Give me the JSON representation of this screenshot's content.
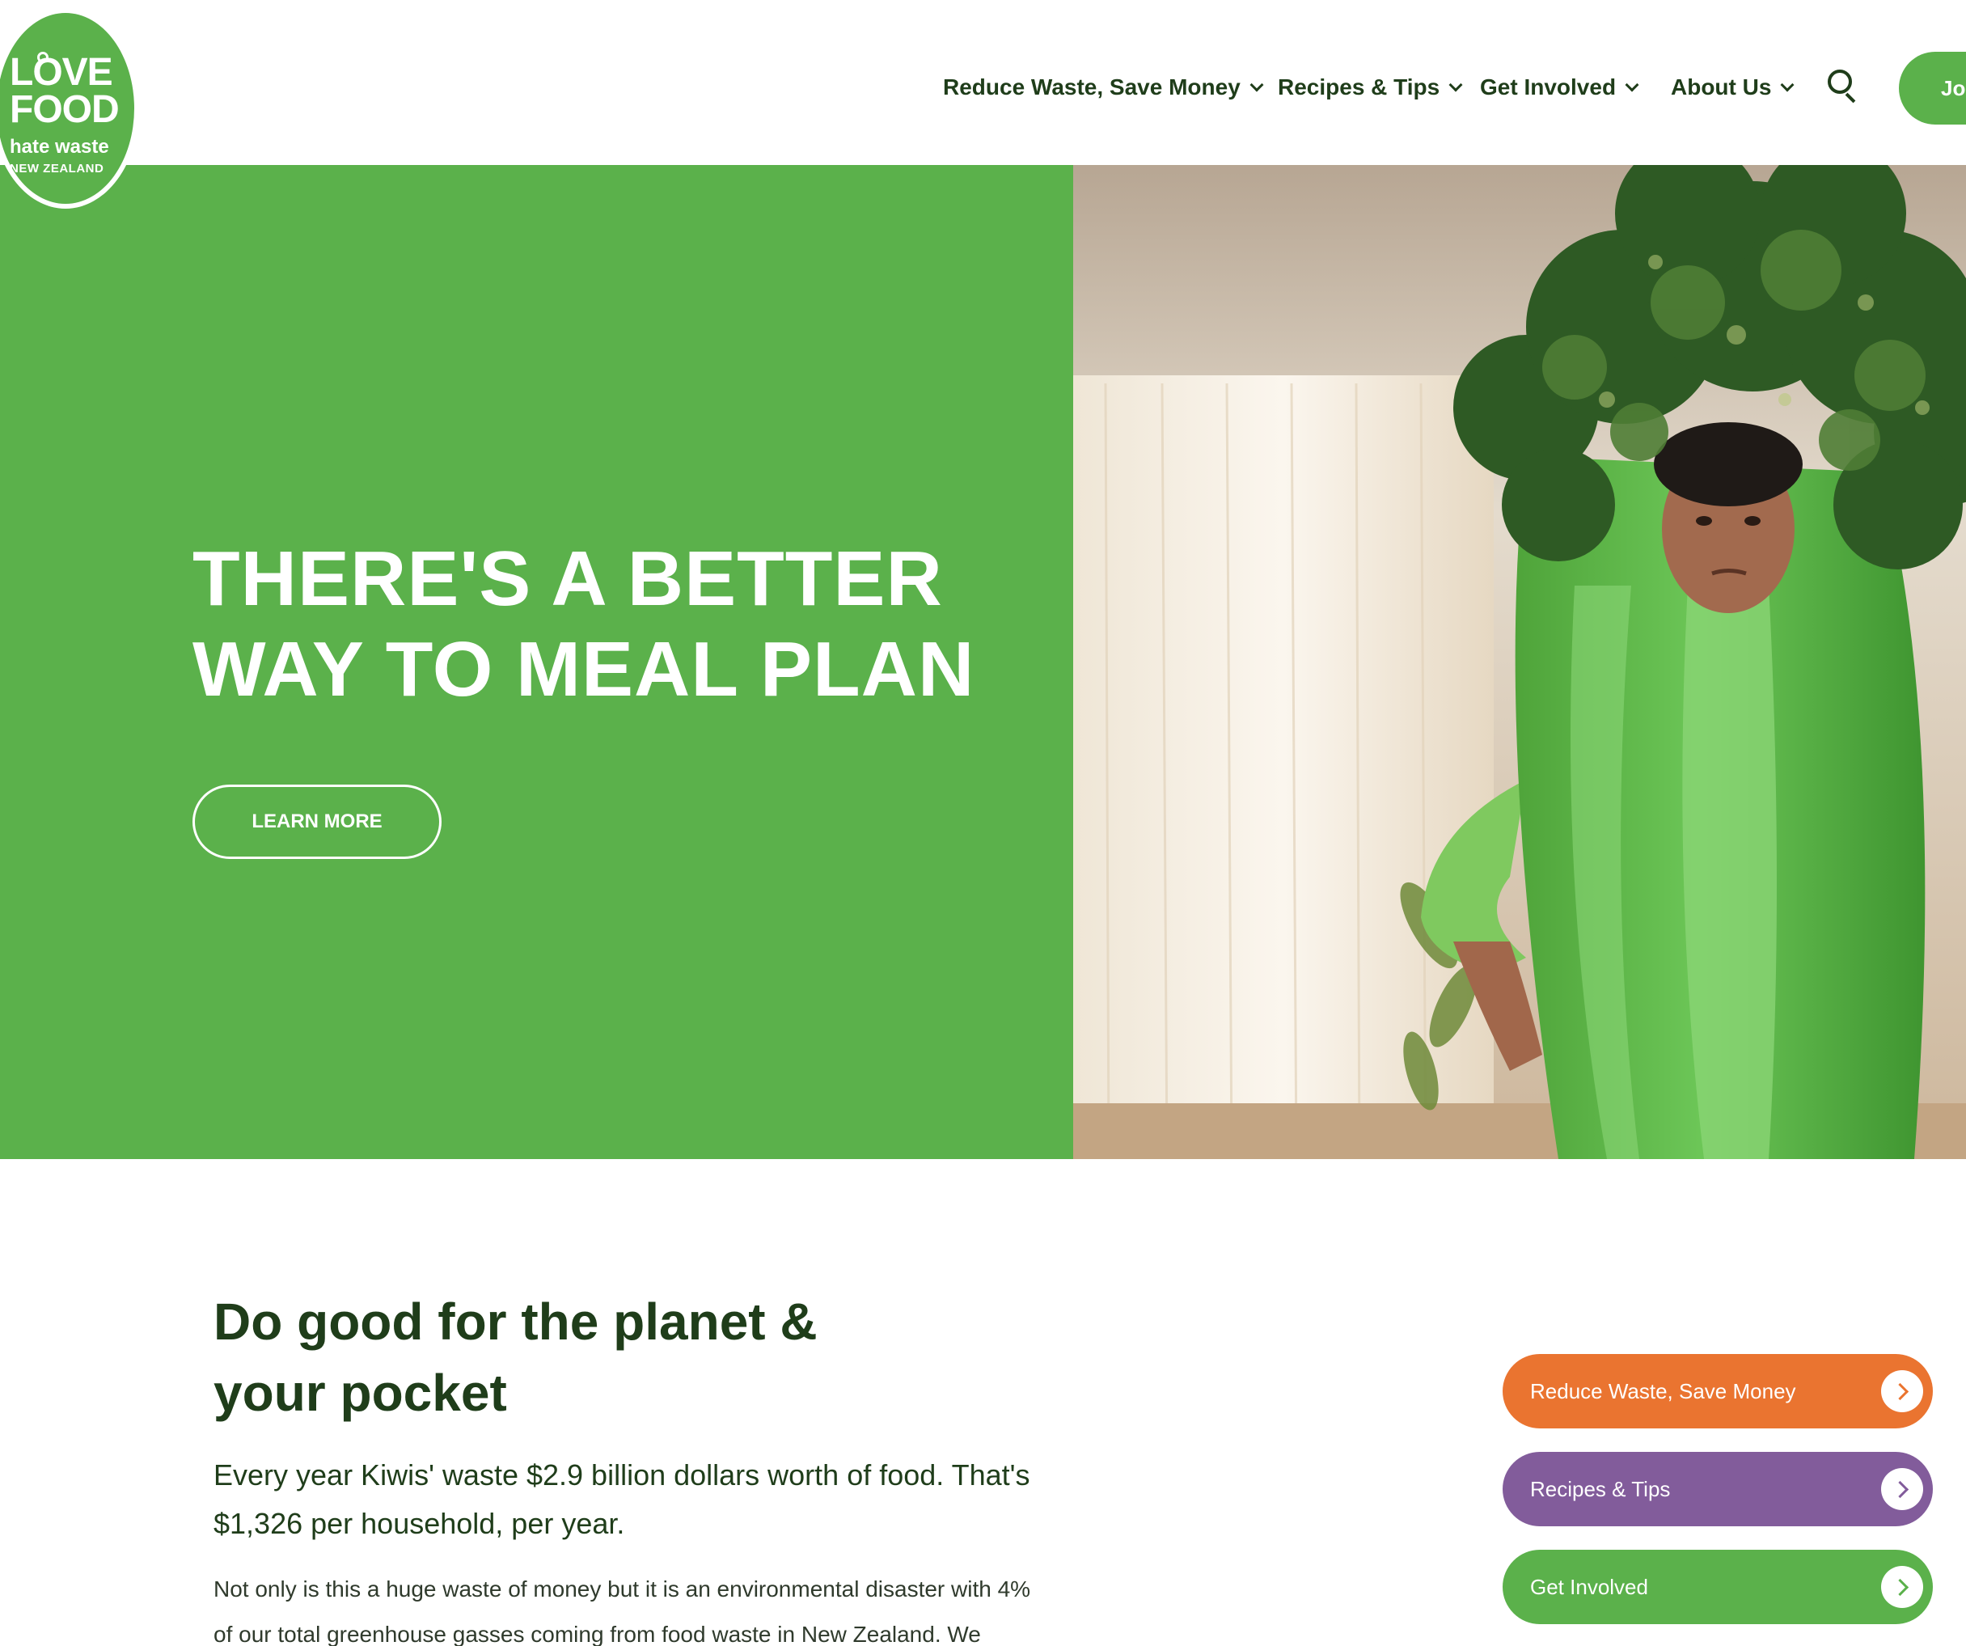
{
  "colors": {
    "brand_green": "#5bb14b",
    "dark_green": "#1f3d1a",
    "orange": "#ea7430",
    "purple": "#825c9b"
  },
  "logo": {
    "line1": "LOVE",
    "line2": "FOOD",
    "line3": "hate waste",
    "line4": "NEW ZEALAND"
  },
  "nav": {
    "items": [
      {
        "label": "Reduce Waste, Save Money",
        "icon": "chevron-down-icon"
      },
      {
        "label": "Recipes & Tips",
        "icon": "chevron-down-icon"
      },
      {
        "label": "Get Involved",
        "icon": "chevron-down-icon"
      },
      {
        "label": "About Us",
        "icon": "chevron-down-icon"
      }
    ],
    "search_icon": "search-icon",
    "join_label": "Join"
  },
  "hero": {
    "title": "THERE'S A BETTER WAY TO MEAL PLAN",
    "button_label": "LEARN MORE"
  },
  "intro": {
    "title": "Do good for the planet & your pocket",
    "lead": "Every year Kiwis' waste $2.9 billion dollars worth of food. That's $1,326 per household, per year.",
    "body": "Not only is this a huge waste of money but it is an environmental disaster with 4% of our total greenhouse gasses coming from food waste in New Zealand. We empower busy"
  },
  "ctas": [
    {
      "label": "Reduce Waste, Save Money",
      "icon": "chevron-right-icon"
    },
    {
      "label": "Recipes & Tips",
      "icon": "chevron-right-icon"
    },
    {
      "label": "Get Involved",
      "icon": "chevron-right-icon"
    }
  ]
}
